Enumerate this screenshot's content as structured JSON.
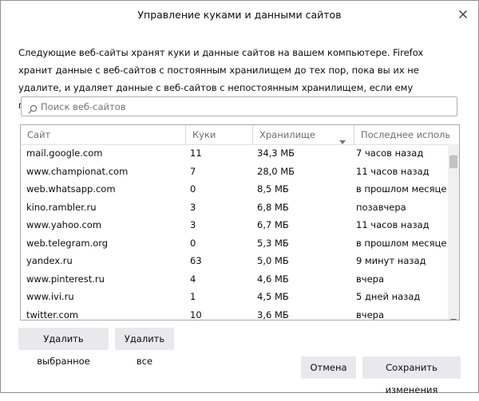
{
  "dialog": {
    "title": "Управление куками и данными сайтов",
    "description": "Следующие веб-сайты хранят куки и данные сайтов на вашем компьютере. Firefox хранит данные с веб-сайтов с постоянным хранилищем до тех пор, пока вы их не удалите, и удаляет данные с веб-сайтов с непостоянным хранилищем, если ему понадобится место."
  },
  "search": {
    "placeholder": "Поиск веб-сайтов",
    "value": ""
  },
  "table": {
    "columns": [
      "Сайт",
      "Куки",
      "Хранилище",
      "Последнее исполь..."
    ],
    "sorted_column": "Хранилище",
    "sort_direction": "descending",
    "rows": [
      {
        "site": "mail.google.com",
        "cookies": "11",
        "storage": "34,3 МБ",
        "last_used": "7 часов назад"
      },
      {
        "site": "www.championat.com",
        "cookies": "7",
        "storage": "28,0 МБ",
        "last_used": "11 часов назад"
      },
      {
        "site": "web.whatsapp.com",
        "cookies": "0",
        "storage": "8,5 МБ",
        "last_used": "в прошлом месяце"
      },
      {
        "site": "kino.rambler.ru",
        "cookies": "3",
        "storage": "6,8 МБ",
        "last_used": "позавчера"
      },
      {
        "site": "www.yahoo.com",
        "cookies": "3",
        "storage": "6,7 МБ",
        "last_used": "11 часов назад"
      },
      {
        "site": "web.telegram.org",
        "cookies": "0",
        "storage": "5,3 МБ",
        "last_used": "в прошлом месяце"
      },
      {
        "site": "yandex.ru",
        "cookies": "63",
        "storage": "5,0 МБ",
        "last_used": "9 минут назад"
      },
      {
        "site": "www.pinterest.ru",
        "cookies": "4",
        "storage": "4,6 МБ",
        "last_used": "вчера"
      },
      {
        "site": "www.ivi.ru",
        "cookies": "1",
        "storage": "4,5 МБ",
        "last_used": "5 дней назад"
      },
      {
        "site": "twitter.com",
        "cookies": "10",
        "storage": "3,6 МБ",
        "last_used": "вчера"
      }
    ]
  },
  "buttons": {
    "remove_selected": "Удалить выбранное",
    "remove_all": "Удалить все",
    "cancel": "Отмена",
    "save": "Сохранить изменения"
  },
  "icons": {
    "close": "close-icon",
    "search": "search-icon",
    "sort": "sort-descending-icon"
  }
}
